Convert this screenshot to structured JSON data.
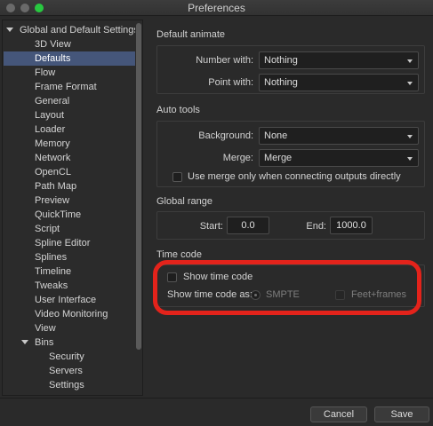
{
  "window": {
    "title": "Preferences"
  },
  "sidebar": {
    "items": [
      {
        "label": "Global and Default Settings",
        "level": 0,
        "expanded": true,
        "selected": false
      },
      {
        "label": "3D View",
        "level": 1,
        "selected": false
      },
      {
        "label": "Defaults",
        "level": 1,
        "selected": true
      },
      {
        "label": "Flow",
        "level": 1,
        "selected": false
      },
      {
        "label": "Frame Format",
        "level": 1,
        "selected": false
      },
      {
        "label": "General",
        "level": 1,
        "selected": false
      },
      {
        "label": "Layout",
        "level": 1,
        "selected": false
      },
      {
        "label": "Loader",
        "level": 1,
        "selected": false
      },
      {
        "label": "Memory",
        "level": 1,
        "selected": false
      },
      {
        "label": "Network",
        "level": 1,
        "selected": false
      },
      {
        "label": "OpenCL",
        "level": 1,
        "selected": false
      },
      {
        "label": "Path Map",
        "level": 1,
        "selected": false
      },
      {
        "label": "Preview",
        "level": 1,
        "selected": false
      },
      {
        "label": "QuickTime",
        "level": 1,
        "selected": false
      },
      {
        "label": "Script",
        "level": 1,
        "selected": false
      },
      {
        "label": "Spline Editor",
        "level": 1,
        "selected": false
      },
      {
        "label": "Splines",
        "level": 1,
        "selected": false
      },
      {
        "label": "Timeline",
        "level": 1,
        "selected": false
      },
      {
        "label": "Tweaks",
        "level": 1,
        "selected": false
      },
      {
        "label": "User Interface",
        "level": 1,
        "selected": false
      },
      {
        "label": "Video Monitoring",
        "level": 1,
        "selected": false
      },
      {
        "label": "View",
        "level": 1,
        "selected": false
      },
      {
        "label": "Bins",
        "level": 1,
        "expanded": true,
        "selected": false
      },
      {
        "label": "Security",
        "level": 2,
        "selected": false
      },
      {
        "label": "Servers",
        "level": 2,
        "selected": false
      },
      {
        "label": "Settings",
        "level": 2,
        "selected": false
      }
    ]
  },
  "default_animate": {
    "title": "Default animate",
    "number_with_label": "Number with:",
    "number_with_value": "Nothing",
    "point_with_label": "Point with:",
    "point_with_value": "Nothing"
  },
  "auto_tools": {
    "title": "Auto tools",
    "background_label": "Background:",
    "background_value": "None",
    "merge_label": "Merge:",
    "merge_value": "Merge",
    "use_merge_label": "Use merge only when connecting outputs directly",
    "use_merge_checked": false
  },
  "global_range": {
    "title": "Global range",
    "start_label": "Start:",
    "start_value": "0.0",
    "end_label": "End:",
    "end_value": "1000.0"
  },
  "time_code": {
    "title": "Time code",
    "show_time_code_label": "Show time code",
    "show_time_code_checked": false,
    "show_as_label": "Show time code as:",
    "smpte_label": "SMPTE",
    "feet_frames_label": "Feet+frames"
  },
  "footer": {
    "cancel_label": "Cancel",
    "save_label": "Save"
  },
  "colors": {
    "highlight_ring": "#e3231b",
    "selection": "#45567a",
    "maximize": "#28c840"
  }
}
